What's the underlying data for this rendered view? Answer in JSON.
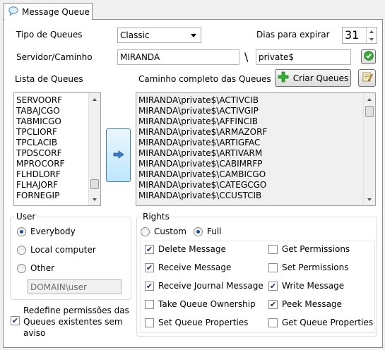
{
  "tab": {
    "label": "Message Queue",
    "icon": "speech-bubble-icon"
  },
  "form": {
    "tipo_label": "Tipo de Queues",
    "tipo_value": "Classic",
    "dias_label": "Dias para expirar",
    "dias_value": "31",
    "servidor_label": "Servidor/Caminho",
    "servidor_value": "MIRANDA",
    "separator": "\\",
    "path_value": "private$"
  },
  "lista": {
    "label": "Lista de Queues",
    "items": [
      "SERVOORF",
      "TABAJCGO",
      "TABMICGO",
      "TPCLIORF",
      "TPCLACIB",
      "TPDSCORF",
      "MPROCORF",
      "FLHDLORF",
      "FLHAJORF",
      "FORNEGIP"
    ]
  },
  "caminho": {
    "label": "Caminho completo das Queues",
    "criar_label": "Criar Queues",
    "items": [
      "MIRANDA\\private$\\ACTIVCIB",
      "MIRANDA\\private$\\ACTIVGIP",
      "MIRANDA\\private$\\AFFINCIB",
      "MIRANDA\\private$\\ARMAZORF",
      "MIRANDA\\private$\\ARTIGFAC",
      "MIRANDA\\private$\\ARTIVARM",
      "MIRANDA\\private$\\CABIMRFP",
      "MIRANDA\\private$\\CAMBICGO",
      "MIRANDA\\private$\\CATEGCGO",
      "MIRANDA\\private$\\CCUSTCIB"
    ]
  },
  "user": {
    "title": "User",
    "everybody": "Everybody",
    "local": "Local computer",
    "other": "Other",
    "other_placeholder": "DOMAIN\\user",
    "selected": "Everybody"
  },
  "redefine": {
    "line1": "Redefine permissões das",
    "line2": "Queues existentes sem",
    "line3": "aviso",
    "checked": true
  },
  "rights": {
    "title": "Rights",
    "custom": "Custom",
    "full": "Full",
    "selected": "Full",
    "left": [
      {
        "label": "Delete Message",
        "checked": true
      },
      {
        "label": "Receive Message",
        "checked": true
      },
      {
        "label": "Receive Journal Message",
        "checked": true
      },
      {
        "label": "Take Queue Ownership",
        "checked": false
      },
      {
        "label": "Set Queue Properties",
        "checked": false
      }
    ],
    "right": [
      {
        "label": "Get Permissions",
        "checked": false
      },
      {
        "label": "Set Permissions",
        "checked": false
      },
      {
        "label": "Write Message",
        "checked": true
      },
      {
        "label": "Peek Message",
        "checked": true
      },
      {
        "label": "Get Queue Properties",
        "checked": false
      }
    ]
  },
  "colors": {
    "accent": "#1a4fa8",
    "panel_border": "#8c8c8c",
    "group_border": "#d5dfe5"
  }
}
